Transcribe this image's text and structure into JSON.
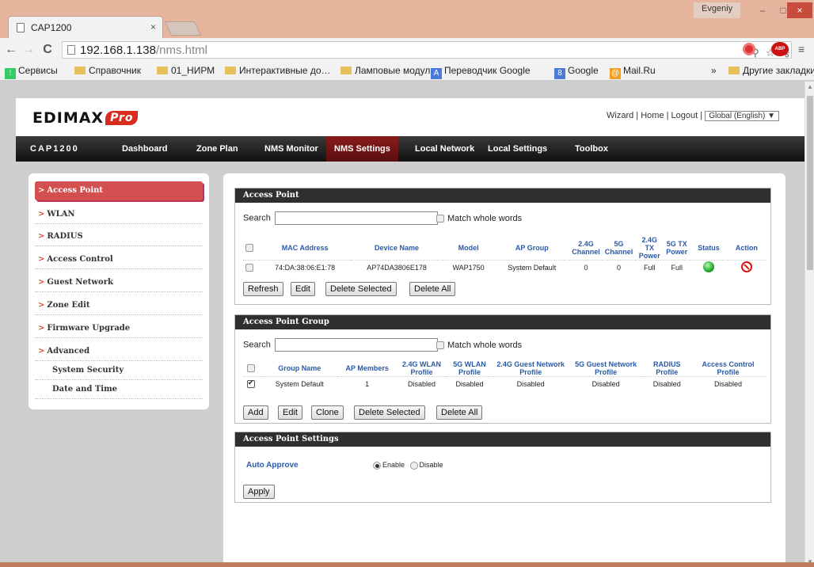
{
  "browser": {
    "tab_title": "CAP1200",
    "tab_close": "×",
    "user": "Evgeniy",
    "win_min": "–",
    "win_max": "□",
    "win_close": "×",
    "url_host": "192.168.1.138",
    "url_path": "/nms.html",
    "bookmarks": [
      "Сервисы",
      "Справочник",
      "01_НИРМ",
      "Интерактивные до…",
      "Ламповые модули",
      "Переводчик Google",
      "Google",
      "Mail.Ru"
    ],
    "bookmarks_more": "»",
    "other_bookmarks": "Другие закладки"
  },
  "header": {
    "logo": "EDIMAX",
    "logo_pro": "Pro",
    "links": [
      "Wizard",
      "Home",
      "Logout"
    ],
    "language": "Global (English)",
    "language_arrow": "▼"
  },
  "nav": {
    "brand": "CAP1200",
    "items": [
      "Dashboard",
      "Zone Plan",
      "NMS Monitor",
      "NMS Settings",
      "Local Network",
      "Local Settings",
      "Toolbox"
    ],
    "active": "NMS Settings"
  },
  "sidebar": {
    "items": [
      "Access Point",
      "WLAN",
      "RADIUS",
      "Access Control",
      "Guest Network",
      "Zone Edit",
      "Firmware Upgrade",
      "Advanced"
    ],
    "subitems": [
      "System Security",
      "Date and Time"
    ],
    "active": "Access Point",
    "arrow": ">"
  },
  "ap_section": {
    "title": "Access Point",
    "search_label": "Search",
    "search_value": "",
    "match_label": "Match whole words",
    "columns": [
      "MAC Address",
      "Device Name",
      "Model",
      "AP Group",
      "2.4G Channel",
      "5G Channel",
      "2.4G TX Power",
      "5G TX Power",
      "Status",
      "Action"
    ],
    "rows": [
      {
        "mac": "74:DA:38:06:E1:78",
        "name": "AP74DA3806E178",
        "model": "WAP1750",
        "group": "System Default",
        "ch24": "0",
        "ch5": "0",
        "tx24": "Full",
        "tx5": "Full",
        "status": "online",
        "action": "delete"
      }
    ],
    "buttons": [
      "Refresh",
      "Edit",
      "Delete Selected",
      "Delete All"
    ]
  },
  "group_section": {
    "title": "Access Point Group",
    "search_label": "Search",
    "search_value": "",
    "match_label": "Match whole words",
    "columns": [
      "Group Name",
      "AP Members",
      "2.4G WLAN Profile",
      "5G WLAN Profile",
      "2.4G Guest Network Profile",
      "5G Guest Network Profile",
      "RADIUS Profile",
      "Access Control Profile"
    ],
    "rows": [
      {
        "checked": true,
        "name": "System Default",
        "members": "1",
        "wlan24": "Disabled",
        "wlan5": "Disabled",
        "guest24": "Disabled",
        "guest5": "Disabled",
        "radius": "Disabled",
        "acl": "Disabled"
      }
    ],
    "buttons": [
      "Add",
      "Edit",
      "Clone",
      "Delete Selected",
      "Delete All"
    ]
  },
  "settings_section": {
    "title": "Access Point Settings",
    "auto_approve_label": "Auto Approve",
    "enable_label": "Enable",
    "disable_label": "Disable",
    "selected": "Enable",
    "apply_label": "Apply"
  },
  "colors": {
    "accent_red": "#d44f4f",
    "nav_active": "#7a1616",
    "link_blue": "#2a5aa8",
    "title_bar": "#e7b59d"
  }
}
